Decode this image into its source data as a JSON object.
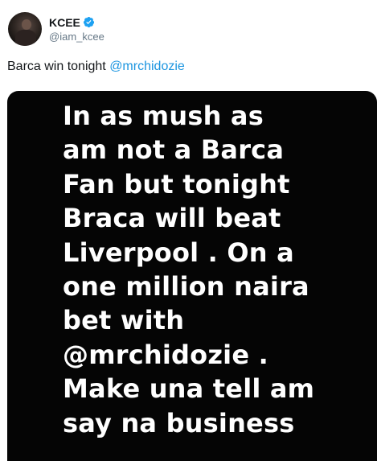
{
  "author": {
    "display_name": "KCEE",
    "handle": "@iam_kcee",
    "verified_icon": "verified-badge-icon",
    "avatar": "profile-photo"
  },
  "tweet": {
    "text_prefix": "Barca win tonight ",
    "mention": "@mrchidozie"
  },
  "media": {
    "lines": [
      "In as mush as",
      "am not a Barca",
      "Fan but tonight",
      "Braca will beat",
      "Liverpool . On a",
      "one million naira",
      "bet with",
      "@mrchidozie .",
      "Make una tell am",
      "say na business"
    ]
  },
  "colors": {
    "link": "#1b95e0",
    "verified": "#1da1f2",
    "handle": "#657786",
    "text": "#14171a",
    "media_background": "#050505"
  }
}
